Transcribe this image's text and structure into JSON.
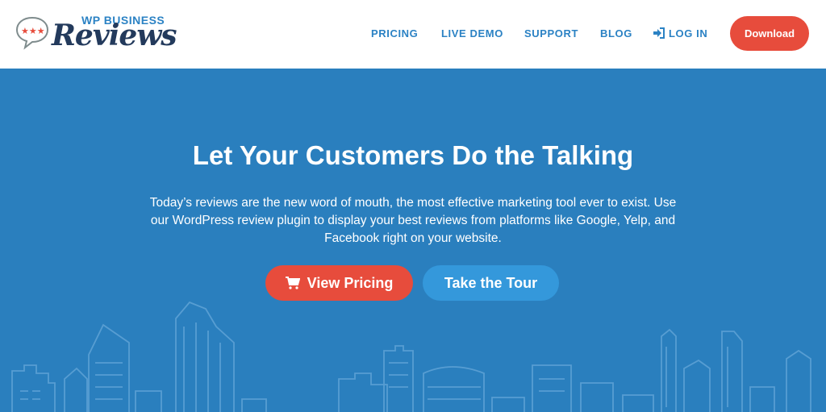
{
  "logo": {
    "top_text": "WP BUSINESS",
    "main_text": "Reviews",
    "icon": "speech-bubble-stars-icon"
  },
  "nav": {
    "items": [
      {
        "label": "PRICING"
      },
      {
        "label": "LIVE DEMO"
      },
      {
        "label": "SUPPORT"
      },
      {
        "label": "BLOG"
      },
      {
        "label": "LOG IN",
        "icon": "login-icon"
      }
    ],
    "download_label": "Download"
  },
  "hero": {
    "headline": "Let Your Customers Do the Talking",
    "subtext": "Today’s reviews are the new word of mouth, the most effective marketing tool ever to exist. Use our WordPress review plugin to display your best reviews from platforms like Google, Yelp, and Facebook right on your website.",
    "primary_button": "View Pricing",
    "primary_icon": "shopping-cart-icon",
    "secondary_button": "Take the Tour",
    "background_illustration": "city-skyline-icon"
  },
  "colors": {
    "brand_blue": "#2b82c4",
    "hero_bg": "#2a7fbe",
    "accent_red": "#e74c3c",
    "button_blue": "#3498db",
    "logo_navy": "#233a5c"
  }
}
